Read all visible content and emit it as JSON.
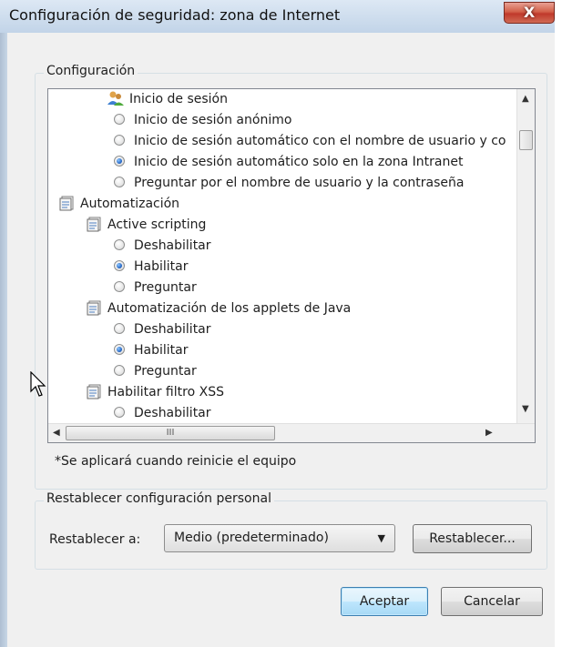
{
  "window": {
    "title": "Configuración de seguridad: zona de Internet",
    "close_label": "X"
  },
  "settings_group": {
    "label": "Configuración"
  },
  "tree": [
    {
      "kind": "group-users",
      "label": "Inicio de sesión"
    },
    {
      "kind": "radio",
      "checked": false,
      "label": "Inicio de sesión anónimo"
    },
    {
      "kind": "radio",
      "checked": false,
      "label": "Inicio de sesión automático con el nombre de usuario y co"
    },
    {
      "kind": "radio",
      "checked": true,
      "label": "Inicio de sesión automático solo en la zona Intranet"
    },
    {
      "kind": "radio",
      "checked": false,
      "label": "Preguntar por el nombre de usuario y la contraseña"
    },
    {
      "kind": "category",
      "label": "Automatización"
    },
    {
      "kind": "setting",
      "label": "Active scripting"
    },
    {
      "kind": "radio",
      "checked": false,
      "label": "Deshabilitar"
    },
    {
      "kind": "radio",
      "checked": true,
      "label": "Habilitar"
    },
    {
      "kind": "radio",
      "checked": false,
      "label": "Preguntar"
    },
    {
      "kind": "setting",
      "label": "Automatización de los applets de Java"
    },
    {
      "kind": "radio",
      "checked": false,
      "label": "Deshabilitar"
    },
    {
      "kind": "radio",
      "checked": true,
      "label": "Habilitar"
    },
    {
      "kind": "radio",
      "checked": false,
      "label": "Preguntar"
    },
    {
      "kind": "setting",
      "label": "Habilitar filtro XSS"
    },
    {
      "kind": "radio",
      "checked": false,
      "label": "Deshabilitar"
    }
  ],
  "scroll": {
    "up_arrow": "▲",
    "down_arrow": "▼",
    "left_arrow": "◀",
    "right_arrow": "▶",
    "thumb_grip": "III"
  },
  "note": "*Se aplicará cuando reinicie el equipo",
  "reset_group": {
    "label": "Restablecer configuración personal",
    "reset_to_label": "Restablecer a:",
    "selected_level": "Medio (predeterminado)",
    "reset_button": "Restablecer..."
  },
  "buttons": {
    "ok": "Aceptar",
    "cancel": "Cancelar"
  }
}
